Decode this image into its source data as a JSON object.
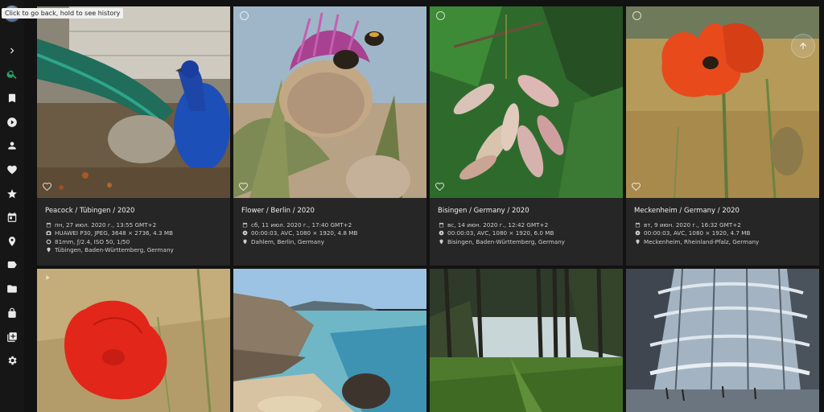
{
  "tooltip": "Click to go back, hold to see history",
  "sidebar": {
    "items": [
      {
        "name": "chevron-right-icon"
      },
      {
        "name": "search-icon"
      },
      {
        "name": "bookmark-icon"
      },
      {
        "name": "play-icon"
      },
      {
        "name": "person-icon"
      },
      {
        "name": "heart-icon"
      },
      {
        "name": "star-icon"
      },
      {
        "name": "calendar-icon"
      },
      {
        "name": "location-pin-icon"
      },
      {
        "name": "label-icon"
      },
      {
        "name": "folder-icon"
      },
      {
        "name": "lock-icon"
      },
      {
        "name": "library-icon"
      },
      {
        "name": "settings-icon"
      }
    ],
    "active_color": "#2e9e6a"
  },
  "cards": [
    {
      "title": "Peacock / Tübingen / 2020",
      "date": "пн, 27 июл. 2020 г., 13:55 GMT+2",
      "camera": "HUAWEI P30, JPEG, 3648 × 2736, 4.3 MB",
      "lens": "81mm, ƒ/2.4, ISO 50, 1/50",
      "place": "Tübingen, Baden-Württemberg, Germany"
    },
    {
      "title": "Flower / Berlin / 2020",
      "date": "сб, 11 июл. 2020 г., 17:40 GMT+2",
      "camera": "00:00:03, AVC, 1080 × 1920, 4.8 MB",
      "place": "Dahlem, Berlin, Germany"
    },
    {
      "title": "Bisingen / Germany / 2020",
      "date": "вс, 14 июн. 2020 г., 12:42 GMT+2",
      "camera": "00:00:03, AVC, 1080 × 1920, 6.0 MB",
      "place": "Bisingen, Baden-Württemberg, Germany"
    },
    {
      "title": "Meckenheim / Germany / 2020",
      "date": "вт, 9 июн. 2020 г., 16:32 GMT+2",
      "camera": "00:00:03, AVC, 1080 × 1920, 4.7 MB",
      "place": "Meckenheim, Rheinland-Pfalz, Germany"
    }
  ]
}
